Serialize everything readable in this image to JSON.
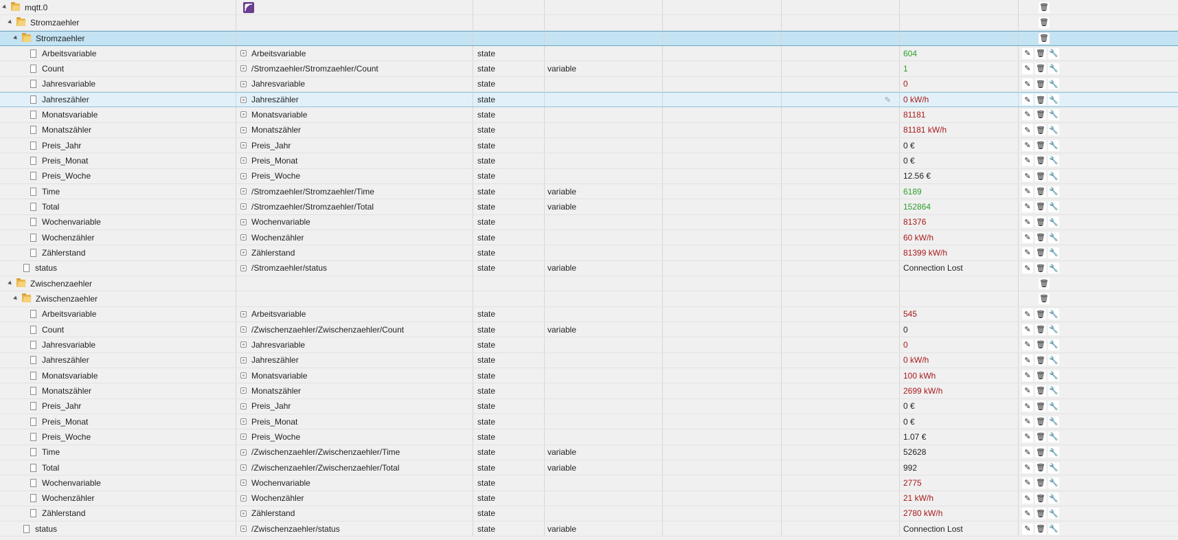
{
  "icons": {
    "edit": "pencil-icon",
    "delete": "trash-icon",
    "settings": "wrench-icon",
    "expanded": "triangle-expanded-icon",
    "folder": "folder-icon",
    "file": "file-icon",
    "state": "state-icon",
    "adapter_logo": "mqtt-logo-icon"
  },
  "glyphs": {
    "edit": "✎",
    "delete": "🗑",
    "settings": "🔧"
  },
  "colors": {
    "green": "#2ca02c",
    "red": "#a8191a",
    "selected_row": "#c4e3f3"
  },
  "rows": [
    {
      "kind": "root",
      "level": 0,
      "id": "mqtt.0",
      "logo": true,
      "buttons": [
        "delete"
      ]
    },
    {
      "kind": "folder",
      "level": 1,
      "id": "Stromzaehler",
      "buttons": [
        "delete"
      ]
    },
    {
      "kind": "folder",
      "level": 2,
      "id": "Stromzaehler",
      "buttons": [
        "delete"
      ],
      "selected": true
    },
    {
      "kind": "state",
      "level": 3,
      "id": "Arbeitsvariable",
      "name": "Arbeitsvariable",
      "type": "state",
      "role": "",
      "value": "604",
      "color": "green",
      "buttons": [
        "edit",
        "delete",
        "settings"
      ]
    },
    {
      "kind": "state",
      "level": 3,
      "id": "Count",
      "name": "/Stromzaehler/Stromzaehler/Count",
      "type": "state",
      "role": "variable",
      "value": "1",
      "color": "green",
      "buttons": [
        "edit",
        "delete",
        "settings"
      ]
    },
    {
      "kind": "state",
      "level": 3,
      "id": "Jahresvariable",
      "name": "Jahresvariable",
      "type": "state",
      "role": "",
      "value": "0",
      "color": "red",
      "buttons": [
        "edit",
        "delete",
        "settings"
      ]
    },
    {
      "kind": "state",
      "level": 3,
      "id": "Jahreszähler",
      "name": "Jahreszähler",
      "type": "state",
      "role": "",
      "value": "0 kW/h",
      "color": "red",
      "buttons": [
        "edit",
        "delete",
        "settings"
      ],
      "hover": true
    },
    {
      "kind": "state",
      "level": 3,
      "id": "Monatsvariable",
      "name": "Monatsvariable",
      "type": "state",
      "role": "",
      "value": "81181",
      "color": "red",
      "buttons": [
        "edit",
        "delete",
        "settings"
      ]
    },
    {
      "kind": "state",
      "level": 3,
      "id": "Monatszähler",
      "name": "Monatszähler",
      "type": "state",
      "role": "",
      "value": "81181 kW/h",
      "color": "red",
      "buttons": [
        "edit",
        "delete",
        "settings"
      ]
    },
    {
      "kind": "state",
      "level": 3,
      "id": "Preis_Jahr",
      "name": "Preis_Jahr",
      "type": "state",
      "role": "",
      "value": "0 €",
      "color": "black",
      "buttons": [
        "edit",
        "delete",
        "settings"
      ]
    },
    {
      "kind": "state",
      "level": 3,
      "id": "Preis_Monat",
      "name": "Preis_Monat",
      "type": "state",
      "role": "",
      "value": "0 €",
      "color": "black",
      "buttons": [
        "edit",
        "delete",
        "settings"
      ]
    },
    {
      "kind": "state",
      "level": 3,
      "id": "Preis_Woche",
      "name": "Preis_Woche",
      "type": "state",
      "role": "",
      "value": "12.56 €",
      "color": "black",
      "buttons": [
        "edit",
        "delete",
        "settings"
      ]
    },
    {
      "kind": "state",
      "level": 3,
      "id": "Time",
      "name": "/Stromzaehler/Stromzaehler/Time",
      "type": "state",
      "role": "variable",
      "value": "6189",
      "color": "green",
      "buttons": [
        "edit",
        "delete",
        "settings"
      ]
    },
    {
      "kind": "state",
      "level": 3,
      "id": "Total",
      "name": "/Stromzaehler/Stromzaehler/Total",
      "type": "state",
      "role": "variable",
      "value": "152864",
      "color": "green",
      "buttons": [
        "edit",
        "delete",
        "settings"
      ]
    },
    {
      "kind": "state",
      "level": 3,
      "id": "Wochenvariable",
      "name": "Wochenvariable",
      "type": "state",
      "role": "",
      "value": "81376",
      "color": "red",
      "buttons": [
        "edit",
        "delete",
        "settings"
      ]
    },
    {
      "kind": "state",
      "level": 3,
      "id": "Wochenzähler",
      "name": "Wochenzähler",
      "type": "state",
      "role": "",
      "value": "60 kW/h",
      "color": "red",
      "buttons": [
        "edit",
        "delete",
        "settings"
      ]
    },
    {
      "kind": "state",
      "level": 3,
      "id": "Zählerstand",
      "name": "Zählerstand",
      "type": "state",
      "role": "",
      "value": "81399 kW/h",
      "color": "red",
      "buttons": [
        "edit",
        "delete",
        "settings"
      ]
    },
    {
      "kind": "state",
      "level": 2,
      "id": "status",
      "name": "/Stromzaehler/status",
      "type": "state",
      "role": "variable",
      "value": "Connection Lost",
      "color": "black",
      "buttons": [
        "edit",
        "delete",
        "settings"
      ]
    },
    {
      "kind": "folder",
      "level": 1,
      "id": "Zwischenzaehler",
      "buttons": [
        "delete"
      ]
    },
    {
      "kind": "folder",
      "level": 2,
      "id": "Zwischenzaehler",
      "buttons": [
        "delete"
      ]
    },
    {
      "kind": "state",
      "level": 3,
      "id": "Arbeitsvariable",
      "name": "Arbeitsvariable",
      "type": "state",
      "role": "",
      "value": "545",
      "color": "red",
      "buttons": [
        "edit",
        "delete",
        "settings"
      ]
    },
    {
      "kind": "state",
      "level": 3,
      "id": "Count",
      "name": "/Zwischenzaehler/Zwischenzaehler/Count",
      "type": "state",
      "role": "variable",
      "value": "0",
      "color": "black",
      "buttons": [
        "edit",
        "delete",
        "settings"
      ]
    },
    {
      "kind": "state",
      "level": 3,
      "id": "Jahresvariable",
      "name": "Jahresvariable",
      "type": "state",
      "role": "",
      "value": "0",
      "color": "red",
      "buttons": [
        "edit",
        "delete",
        "settings"
      ]
    },
    {
      "kind": "state",
      "level": 3,
      "id": "Jahreszähler",
      "name": "Jahreszähler",
      "type": "state",
      "role": "",
      "value": "0 kW/h",
      "color": "red",
      "buttons": [
        "edit",
        "delete",
        "settings"
      ]
    },
    {
      "kind": "state",
      "level": 3,
      "id": "Monatsvariable",
      "name": "Monatsvariable",
      "type": "state",
      "role": "",
      "value": "100 kWh",
      "color": "red",
      "buttons": [
        "edit",
        "delete",
        "settings"
      ]
    },
    {
      "kind": "state",
      "level": 3,
      "id": "Monatszähler",
      "name": "Monatszähler",
      "type": "state",
      "role": "",
      "value": "2699 kW/h",
      "color": "red",
      "buttons": [
        "edit",
        "delete",
        "settings"
      ]
    },
    {
      "kind": "state",
      "level": 3,
      "id": "Preis_Jahr",
      "name": "Preis_Jahr",
      "type": "state",
      "role": "",
      "value": "0 €",
      "color": "black",
      "buttons": [
        "edit",
        "delete",
        "settings"
      ]
    },
    {
      "kind": "state",
      "level": 3,
      "id": "Preis_Monat",
      "name": "Preis_Monat",
      "type": "state",
      "role": "",
      "value": "0 €",
      "color": "black",
      "buttons": [
        "edit",
        "delete",
        "settings"
      ]
    },
    {
      "kind": "state",
      "level": 3,
      "id": "Preis_Woche",
      "name": "Preis_Woche",
      "type": "state",
      "role": "",
      "value": "1.07 €",
      "color": "black",
      "buttons": [
        "edit",
        "delete",
        "settings"
      ]
    },
    {
      "kind": "state",
      "level": 3,
      "id": "Time",
      "name": "/Zwischenzaehler/Zwischenzaehler/Time",
      "type": "state",
      "role": "variable",
      "value": "52628",
      "color": "black",
      "buttons": [
        "edit",
        "delete",
        "settings"
      ]
    },
    {
      "kind": "state",
      "level": 3,
      "id": "Total",
      "name": "/Zwischenzaehler/Zwischenzaehler/Total",
      "type": "state",
      "role": "variable",
      "value": "992",
      "color": "black",
      "buttons": [
        "edit",
        "delete",
        "settings"
      ]
    },
    {
      "kind": "state",
      "level": 3,
      "id": "Wochenvariable",
      "name": "Wochenvariable",
      "type": "state",
      "role": "",
      "value": "2775",
      "color": "red",
      "buttons": [
        "edit",
        "delete",
        "settings"
      ]
    },
    {
      "kind": "state",
      "level": 3,
      "id": "Wochenzähler",
      "name": "Wochenzähler",
      "type": "state",
      "role": "",
      "value": "21 kW/h",
      "color": "red",
      "buttons": [
        "edit",
        "delete",
        "settings"
      ]
    },
    {
      "kind": "state",
      "level": 3,
      "id": "Zählerstand",
      "name": "Zählerstand",
      "type": "state",
      "role": "",
      "value": "2780 kW/h",
      "color": "red",
      "buttons": [
        "edit",
        "delete",
        "settings"
      ]
    },
    {
      "kind": "state",
      "level": 2,
      "id": "status",
      "name": "/Zwischenzaehler/status",
      "type": "state",
      "role": "variable",
      "value": "Connection Lost",
      "color": "black",
      "buttons": [
        "edit",
        "delete",
        "settings"
      ]
    }
  ]
}
